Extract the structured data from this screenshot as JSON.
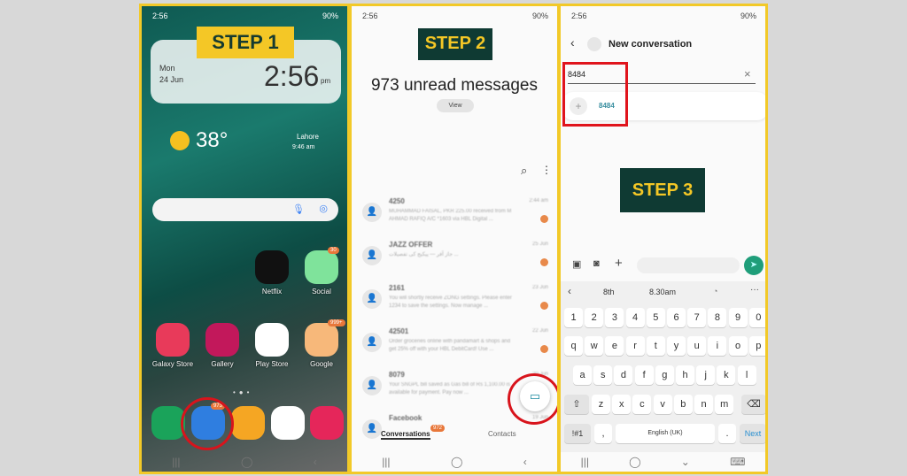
{
  "status": {
    "time": "2:56",
    "battery": "90%"
  },
  "step1": {
    "label": "STEP 1",
    "date_day": "Mon",
    "date": "24 Jun",
    "clock": "2:56",
    "ampm": "pm",
    "temp": "38°",
    "city": "Lahore",
    "weather_time": "9:46 am",
    "apps": [
      {
        "name": "Netflix",
        "color": "#111"
      },
      {
        "name": "Social",
        "color": "#7fe39b",
        "badge": "30"
      },
      {
        "name": "Galaxy Store",
        "color": "#e83a5a"
      },
      {
        "name": "Gallery",
        "color": "#c2185b"
      },
      {
        "name": "Play Store",
        "color": "#ffffff"
      },
      {
        "name": "Google",
        "color": "#f7b87a",
        "badge": "999+"
      }
    ],
    "dock": [
      {
        "name": "Phone",
        "color": "#1aa35a"
      },
      {
        "name": "Messages",
        "color": "#2f7ee0",
        "badge": "973"
      },
      {
        "name": "My Files",
        "color": "#f5a623"
      },
      {
        "name": "Chrome",
        "color": "#ffffff"
      },
      {
        "name": "Camera",
        "color": "#e5265a"
      }
    ]
  },
  "step2": {
    "label": "STEP 2",
    "unread": "973 unread messages",
    "view": "View",
    "conversations": [
      {
        "name": "4250",
        "time": "2:44 am",
        "text": "MUHAMMAD FAISAL, PKR 225.00 received from M AHMAD RAFIQ A/C *1603 via HBL Digital ..."
      },
      {
        "name": "JAZZ OFFER",
        "time": "25 Jun",
        "text": "جاز آفر — پیکیج کی تفصیلات ..."
      },
      {
        "name": "2161",
        "time": "23 Jun",
        "text": "You will shortly receive ZONG settings. Please enter 1234 to save the settings. Now manage ..."
      },
      {
        "name": "42501",
        "time": "22 Jun",
        "text": "Order groceries online with pandamart & shops and get 25% off with your HBL DebitCard! Use ..."
      },
      {
        "name": "8079",
        "time": "20 Jun",
        "text": "Your SNGPL bill saved as Gas bill of Rs 1,100.00 is available for payment. Pay now ..."
      },
      {
        "name": "Facebook",
        "time": "19 Jun",
        "text": ""
      }
    ],
    "tab_conversations": "Conversations",
    "tab_badge": "972",
    "tab_contacts": "Contacts"
  },
  "step3": {
    "label": "STEP 3",
    "title": "New conversation",
    "input": "8484",
    "suggestion": "8484",
    "kb_suggestions": [
      "8th",
      "8.30am"
    ],
    "keys": [
      [
        "1",
        "2",
        "3",
        "4",
        "5",
        "6",
        "7",
        "8",
        "9",
        "0"
      ],
      [
        "q",
        "w",
        "e",
        "r",
        "t",
        "y",
        "u",
        "i",
        "o",
        "p"
      ],
      [
        "a",
        "s",
        "d",
        "f",
        "g",
        "h",
        "j",
        "k",
        "l"
      ],
      [
        "z",
        "x",
        "c",
        "v",
        "b",
        "n",
        "m"
      ]
    ],
    "sym": "!#1",
    "comma": ",",
    "space": "English (UK)",
    "period": ".",
    "next": "Next",
    "send_color": "#1f9e7a"
  }
}
